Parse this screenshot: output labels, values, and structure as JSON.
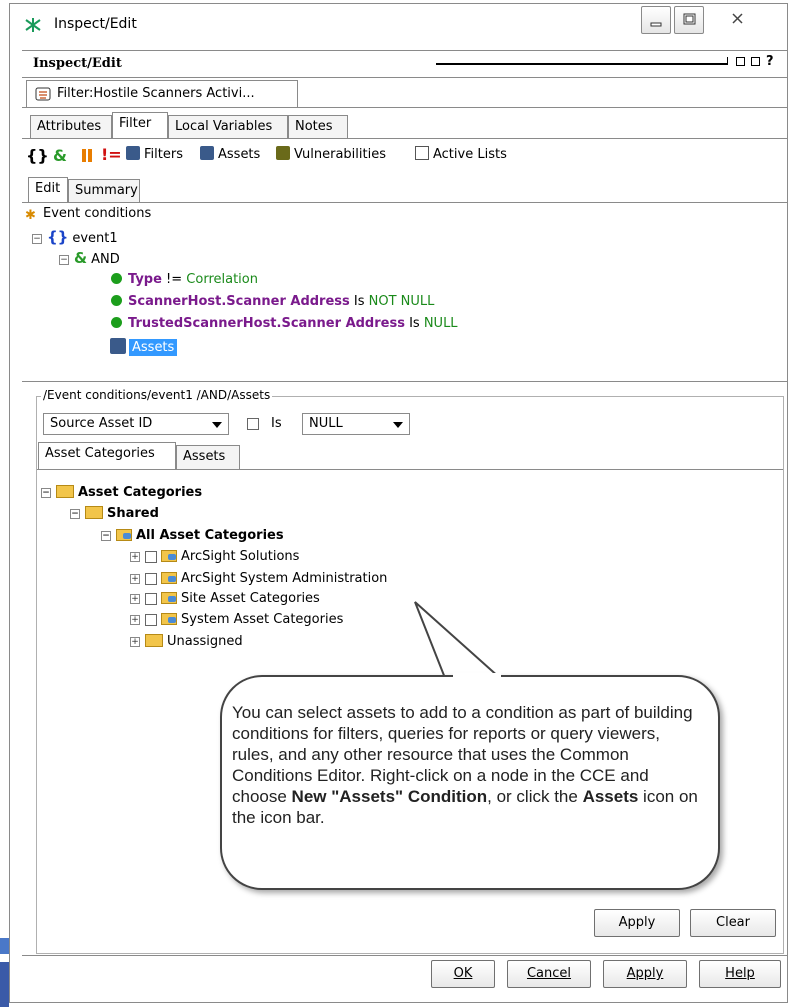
{
  "window": {
    "title": "Inspect/Edit"
  },
  "header": {
    "title": "Inspect/Edit"
  },
  "resource_tab": {
    "label": "Filter:Hostile Scanners Activi..."
  },
  "tabs": [
    {
      "label": "Attributes"
    },
    {
      "label": "Filter",
      "active": true
    },
    {
      "label": "Local Variables"
    },
    {
      "label": "Notes"
    }
  ],
  "toolbar": {
    "filters": "Filters",
    "assets": "Assets",
    "vulnerabilities": "Vulnerabilities",
    "active_lists": "Active Lists"
  },
  "subtabs": [
    {
      "label": "Edit",
      "active": true
    },
    {
      "label": "Summary"
    }
  ],
  "tree": {
    "root": "Event conditions",
    "event": "event1",
    "op": "AND",
    "conditions": [
      {
        "field": "Type",
        "op": " != ",
        "value": "Correlation"
      },
      {
        "field": "ScannerHost.Scanner Address",
        "op": " Is ",
        "value": "NOT NULL"
      },
      {
        "field": "TrustedScannerHost.Scanner Address",
        "op": " Is ",
        "value": "NULL"
      }
    ],
    "assets": "Assets"
  },
  "path_group": {
    "label": "/Event conditions/event1 /AND/Assets"
  },
  "filter_row": {
    "field_select": "Source Asset ID",
    "is_label": "Is",
    "value_select": "NULL"
  },
  "asset_tabs": [
    {
      "label": "Asset Categories",
      "active": true
    },
    {
      "label": "Assets"
    }
  ],
  "asset_tree": {
    "root": "Asset Categories",
    "shared": "Shared",
    "all": "All Asset Categories",
    "items": [
      "ArcSight Solutions",
      "ArcSight System Administration",
      "Site Asset Categories",
      "System Asset Categories"
    ],
    "unassigned": "Unassigned"
  },
  "callout": {
    "part1": "You can select assets to add to a condition as part of building conditions for filters, queries for reports or query viewers, rules, and any other resource that uses the Common Conditions Editor. Right-click on a node in the CCE and choose ",
    "bold1": "New \"Assets\" Condition",
    "part2": ", or click the ",
    "bold2": "Assets",
    "part3": " icon on the icon bar."
  },
  "inner_buttons": {
    "apply": "Apply",
    "clear": "Clear"
  },
  "footer_buttons": {
    "ok": "OK",
    "cancel": "Cancel",
    "apply": "Apply",
    "help": "Help"
  },
  "colors": {
    "keyword": "#7a1a8c",
    "value": "#1a8a1a",
    "selection": "#3399ff"
  }
}
